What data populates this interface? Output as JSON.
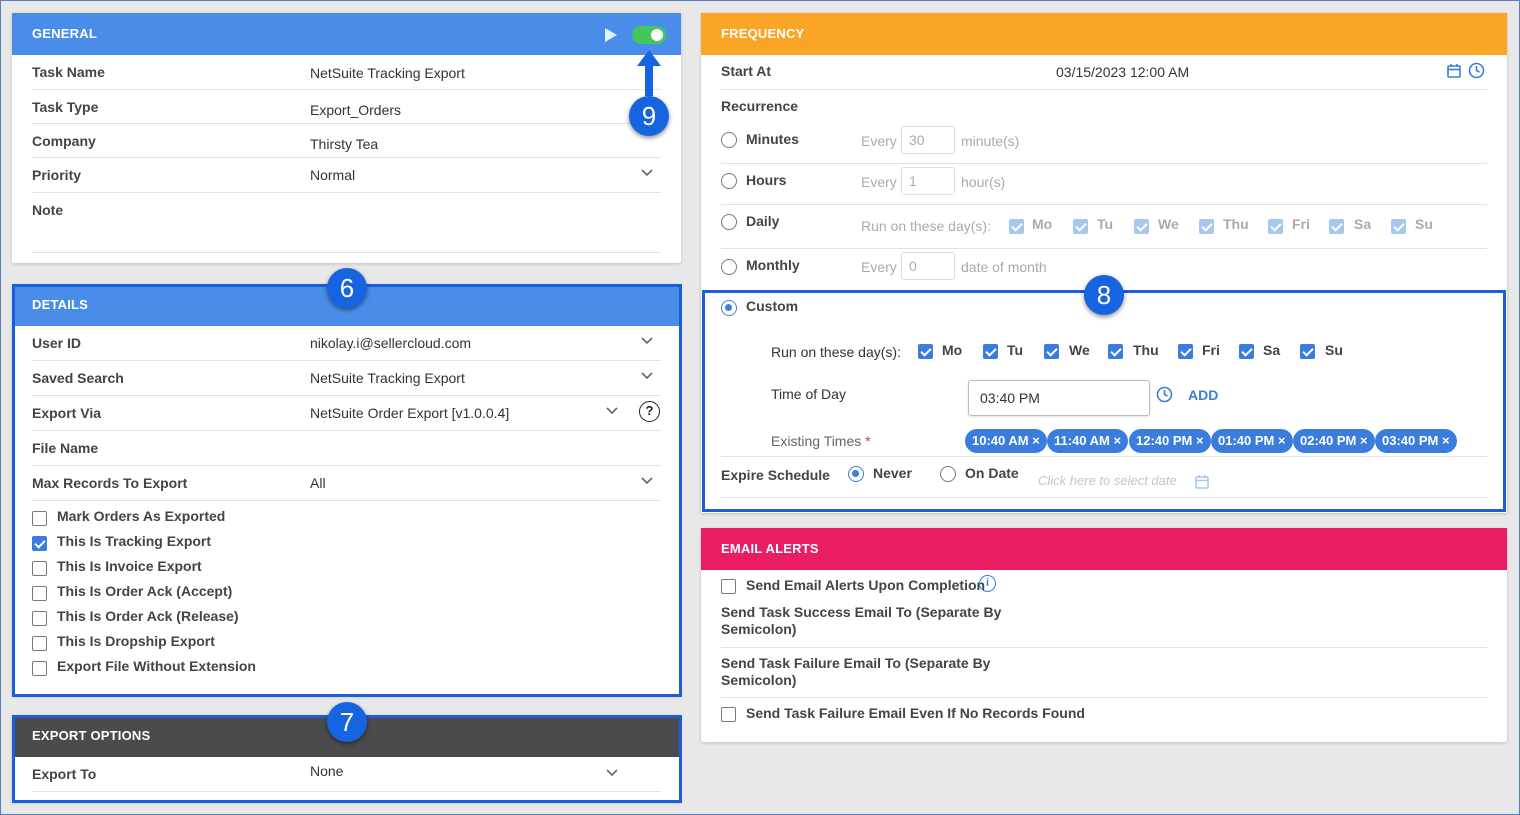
{
  "general": {
    "title": "GENERAL",
    "fields": [
      {
        "label": "Task Name",
        "value": "NetSuite Tracking Export"
      },
      {
        "label": "Task Type",
        "value": "Export_Orders"
      },
      {
        "label": "Company",
        "value": "Thirsty Tea"
      },
      {
        "label": "Priority",
        "value": "Normal"
      },
      {
        "label": "Note",
        "value": ""
      }
    ]
  },
  "details": {
    "title": "DETAILS",
    "fields": [
      {
        "label": "User ID",
        "value": "nikolay.i@sellercloud.com"
      },
      {
        "label": "Saved Search",
        "value": "NetSuite Tracking Export"
      },
      {
        "label": "Export Via",
        "value": "NetSuite Order Export [v1.0.0.4]"
      },
      {
        "label": "File Name",
        "value": ""
      },
      {
        "label": "Max Records To Export",
        "value": "All"
      }
    ],
    "checkboxes": [
      {
        "label": "Mark Orders As Exported",
        "checked": false
      },
      {
        "label": "This Is Tracking Export",
        "checked": true
      },
      {
        "label": "This Is Invoice Export",
        "checked": false
      },
      {
        "label": "This Is Order Ack (Accept)",
        "checked": false
      },
      {
        "label": "This Is Order Ack (Release)",
        "checked": false
      },
      {
        "label": "This Is Dropship Export",
        "checked": false
      },
      {
        "label": "Export File Without Extension",
        "checked": false
      }
    ]
  },
  "export_options": {
    "title": "EXPORT OPTIONS",
    "export_to_label": "Export To",
    "export_to_value": "None"
  },
  "frequency": {
    "title": "FREQUENCY",
    "start_at_label": "Start At",
    "start_at_value": "03/15/2023 12:00 AM",
    "recurrence_label": "Recurrence",
    "minutes": {
      "label": "Minutes",
      "every": "Every",
      "value": "30",
      "unit": "minute(s)"
    },
    "hours": {
      "label": "Hours",
      "every": "Every",
      "value": "1",
      "unit": "hour(s)"
    },
    "daily": {
      "label": "Daily",
      "run_on": "Run on these day(s):"
    },
    "monthly": {
      "label": "Monthly",
      "every": "Every",
      "value": "0",
      "unit": "date of month"
    },
    "days": [
      "Mo",
      "Tu",
      "We",
      "Thu",
      "Fri",
      "Sa",
      "Su"
    ],
    "custom": {
      "label": "Custom",
      "run_on": "Run on these day(s):",
      "time_of_day_label": "Time of Day",
      "time_of_day_value": "03:40 PM",
      "add_label": "ADD",
      "existing_label": "Existing Times",
      "required_mark": "*",
      "times": [
        "10:40 AM",
        "11:40 AM",
        "12:40 PM",
        "01:40 PM",
        "02:40 PM",
        "03:40 PM"
      ]
    },
    "expire": {
      "label": "Expire Schedule",
      "never": "Never",
      "on_date": "On Date",
      "date_placeholder": "Click here to select date"
    }
  },
  "email_alerts": {
    "title": "EMAIL ALERTS",
    "send_upon_completion": "Send Email Alerts Upon Completion",
    "success_label_1": "Send Task Success Email To (Separate By",
    "success_label_2": "Semicolon)",
    "failure_label_1": "Send Task Failure Email To (Separate By",
    "failure_label_2": "Semicolon)",
    "failure_no_records": "Send Task Failure Email Even If No Records Found"
  },
  "callouts": {
    "n6": "6",
    "n7": "7",
    "n8": "8",
    "n9": "9"
  },
  "colors": {
    "accent": "#3b7ddd",
    "general": "#4a8de8",
    "frequency": "#fba526",
    "email": "#ea1d63",
    "export": "#4b4b4b",
    "callout": "#1664e0"
  }
}
